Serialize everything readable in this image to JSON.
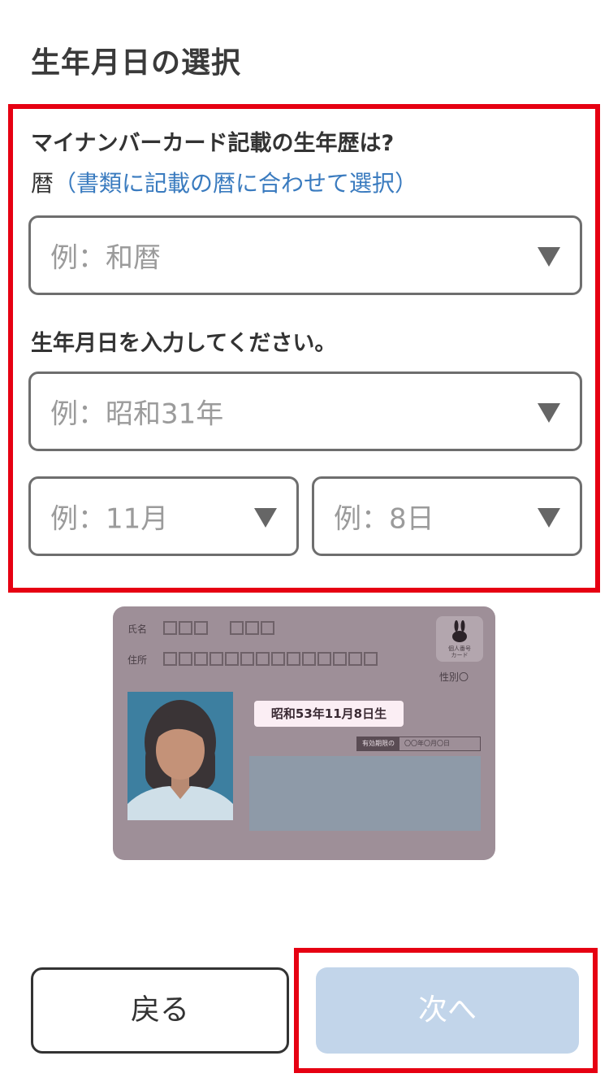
{
  "page": {
    "title": "生年月日の選択"
  },
  "form": {
    "era_question": "マイナンバーカード記載の生年歴は?",
    "era_help_prefix": "暦",
    "era_help_link": "（書類に記載の暦に合わせて選択）",
    "era_select_placeholder": "例：和暦",
    "dob_question": "生年月日を入力してください。",
    "year_select_placeholder": "例：昭和31年",
    "month_select_placeholder": "例：11月",
    "day_select_placeholder": "例：8日"
  },
  "card_illustration": {
    "name_label": "氏名",
    "address_label": "住所",
    "emblem_text": "個人番号\nカード",
    "sex_label": "性別〇",
    "dob_badge": "昭和53年11月8日生",
    "validity_tag": "有効期限の",
    "validity_value": "〇〇年〇月〇日"
  },
  "buttons": {
    "back_label": "戻る",
    "next_label": "次へ"
  },
  "colors": {
    "highlight": "#e60012",
    "link": "#3a7bbf",
    "next_disabled": "#c2d5ea"
  }
}
